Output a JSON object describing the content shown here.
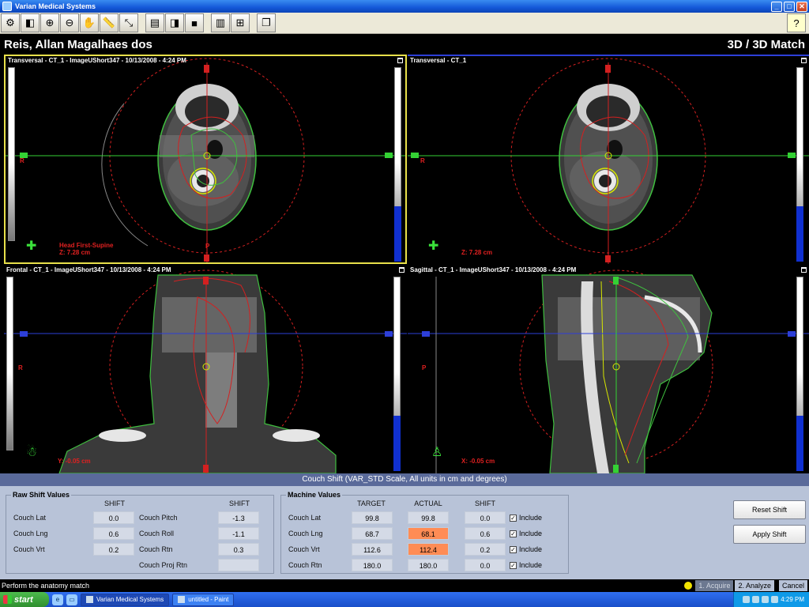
{
  "window": {
    "title": "Varian Medical Systems",
    "buttons": [
      "_",
      "□",
      "✕"
    ]
  },
  "toolbar": {
    "tools": [
      {
        "name": "settings-icon",
        "glyph": "⚙"
      },
      {
        "name": "window-level-icon",
        "glyph": "◧"
      },
      {
        "name": "zoom-in-icon",
        "glyph": "⊕"
      },
      {
        "name": "zoom-out-icon",
        "glyph": "⊖"
      },
      {
        "name": "pan-hand-icon",
        "glyph": "✋"
      },
      {
        "name": "ruler-icon",
        "glyph": "📏"
      },
      {
        "name": "crosshair-tool-icon",
        "glyph": "⤡"
      },
      {
        "name": "overlay-icon",
        "glyph": "▤"
      },
      {
        "name": "layout-split-icon",
        "glyph": "◨"
      },
      {
        "name": "layout-single-icon",
        "glyph": "■"
      },
      {
        "name": "blend-icon",
        "glyph": "▥"
      },
      {
        "name": "match-icon",
        "glyph": "⊞"
      },
      {
        "name": "window-icon",
        "glyph": "❐"
      }
    ],
    "help_glyph": "?"
  },
  "patient": {
    "name": "Reis, Allan Magalhaes dos",
    "mode": "3D / 3D Match"
  },
  "viewports": {
    "tl": {
      "label": "Transversal - CT_1 - ImageUShort347 - 10/13/2008 - 4:24 PM",
      "orientation": "Head First-Supine",
      "coord": "Z: 7.28 cm",
      "side_r": "R",
      "side_p": "P"
    },
    "tr": {
      "label": "Transversal - CT_1",
      "coord": "Z: 7.28 cm",
      "side_r": "R"
    },
    "bl": {
      "label": "Frontal - CT_1 - ImageUShort347 - 10/13/2008 - 4:24 PM",
      "coord": "Y: -0.05 cm",
      "side_r": "R"
    },
    "br": {
      "label": "Sagittal - CT_1 - ImageUShort347 - 10/13/2008 - 4:24 PM",
      "coord": "X: -0.05 cm",
      "side_p": "P"
    }
  },
  "couch_shift": {
    "header": "Couch Shift (VAR_STD Scale, All units in cm and degrees)",
    "raw": {
      "title": "Raw Shift Values",
      "shift_label": "SHIFT",
      "left": [
        {
          "label": "Couch Lat",
          "value": "0.0"
        },
        {
          "label": "Couch Lng",
          "value": "0.6"
        },
        {
          "label": "Couch Vrt",
          "value": "0.2"
        }
      ],
      "right": [
        {
          "label": "Couch Pitch",
          "value": "-1.3"
        },
        {
          "label": "Couch Roll",
          "value": "-1.1"
        },
        {
          "label": "Couch Rtn",
          "value": "0.3"
        },
        {
          "label": "Couch Proj Rtn",
          "value": ""
        }
      ]
    },
    "machine": {
      "title": "Machine Values",
      "col_target": "TARGET",
      "col_actual": "ACTUAL",
      "col_shift": "SHIFT",
      "include_label": "Include",
      "rows": [
        {
          "label": "Couch Lat",
          "target": "99.8",
          "actual": "99.8",
          "shift": "0.0",
          "include": true,
          "warn": false
        },
        {
          "label": "Couch Lng",
          "target": "68.7",
          "actual": "68.1",
          "shift": "0.6",
          "include": true,
          "warn": true
        },
        {
          "label": "Couch Vrt",
          "target": "112.6",
          "actual": "112.4",
          "shift": "0.2",
          "include": true,
          "warn": true
        },
        {
          "label": "Couch Rtn",
          "target": "180.0",
          "actual": "180.0",
          "shift": "0.0",
          "include": true,
          "warn": false
        }
      ]
    },
    "buttons": {
      "reset": "Reset Shift",
      "apply": "Apply Shift"
    }
  },
  "status": {
    "message": "Perform the anatomy match",
    "steps": [
      "1. Acquire",
      "2. Analyze"
    ],
    "cancel": "Cancel"
  },
  "taskbar": {
    "start": "start",
    "tasks": [
      "Varian Medical Systems",
      "untitled - Paint"
    ],
    "clock": "4:29 PM"
  },
  "colors": {
    "contour_green": "#3fbf3f",
    "contour_red": "#d42020",
    "crosshair_green": "#34d134",
    "crosshair_blue": "#2d3fd8",
    "active_viewport": "#e8e04a",
    "warn_actual": "#ff8c55"
  }
}
